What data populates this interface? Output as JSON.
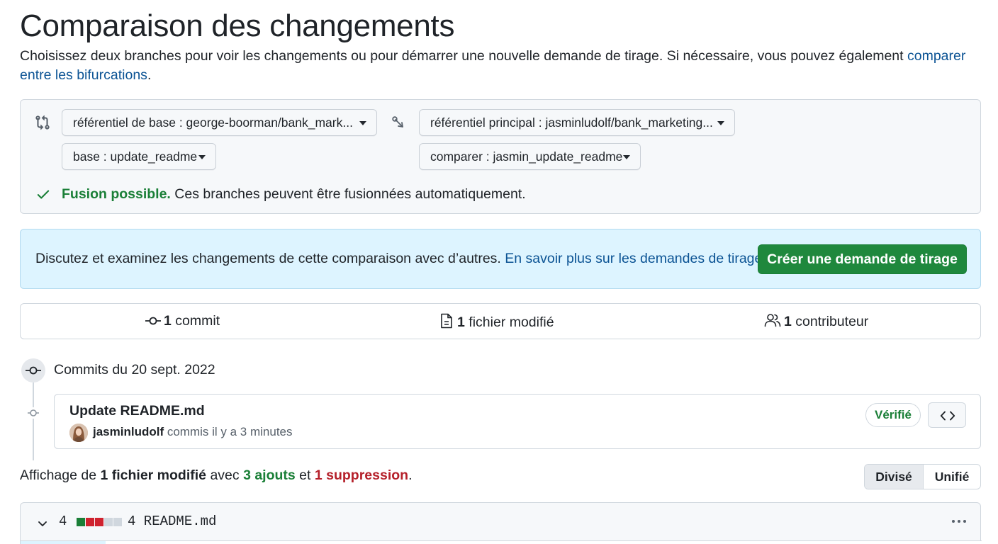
{
  "header": {
    "title": "Comparaison des changements",
    "intro_text": "Choisissez deux branches pour voir les changements ou pour démarrer une nouvelle demande de tirage. Si nécessaire, vous pouvez également ",
    "intro_link": "comparer entre les bifurcations",
    "intro_end": "."
  },
  "compare": {
    "base_repo": "référentiel de base : george-boorman/bank_mark...",
    "head_repo": "référentiel principal : jasminludolf/bank_marketing...",
    "base_branch": "base : update_readme",
    "compare_branch": "comparer : jasmin_update_readme",
    "merge_status": "Fusion possible.",
    "merge_detail": " Ces branches peuvent être fusionnées automatiquement."
  },
  "pull_request": {
    "text": "Discutez et examinez les changements de cette comparaison avec d’autres. ",
    "learn_link": "En savoir plus sur les demandes de tirage",
    "create_button": "Créer une demande de tirage"
  },
  "stats": {
    "commits_count": "1",
    "commits_label": " commit",
    "files_count": "1",
    "files_label": " fichier modifié",
    "contributors_count": "1",
    "contributors_label": " contributeur"
  },
  "commits": {
    "date_heading": "Commits du 20 sept. 2022",
    "items": [
      {
        "title": "Update README.md",
        "author": "jasminludolf",
        "time": " commis il y a 3 minutes",
        "verified": "Vérifié"
      }
    ]
  },
  "summary": {
    "prefix": "Affichage de ",
    "files": "1 fichier modifié",
    "middle": " avec ",
    "additions": "3 ajouts",
    "and": " et ",
    "deletions": "1 suppression",
    "end": "."
  },
  "view_toggle": {
    "split": "Divisé",
    "unified": "Unifié"
  },
  "file": {
    "changes": "4",
    "name": "4 README.md",
    "diffstat": [
      "added",
      "deleted",
      "deleted",
      "neutral",
      "neutral"
    ]
  },
  "colors": {
    "accent_green": "#1f883d",
    "link_blue": "#0b5394",
    "addition_green": "#1a7f37",
    "deletion_red": "#b5202a"
  }
}
